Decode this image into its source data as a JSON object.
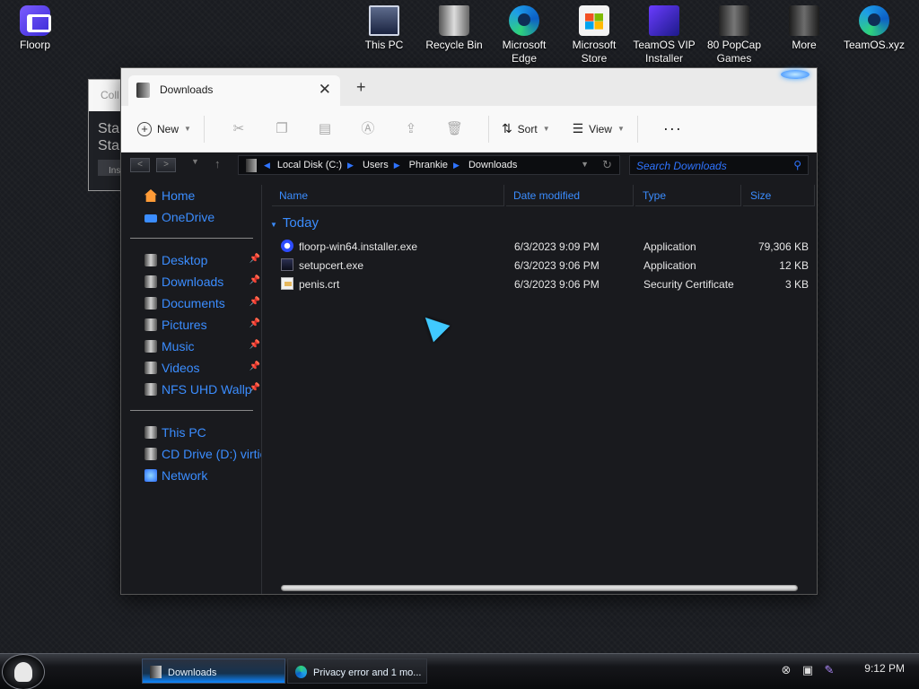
{
  "desktop": {
    "icons": [
      {
        "label": "Floorp",
        "icon": "floorp-icon"
      },
      {
        "label": "This PC",
        "icon": "this-pc-icon"
      },
      {
        "label": "Recycle Bin",
        "icon": "recycle-bin-icon"
      },
      {
        "label": "Microsoft Edge",
        "icon": "edge-icon"
      },
      {
        "label": "Microsoft Store",
        "icon": "store-icon"
      },
      {
        "label": "TeamOS VIP Installer",
        "icon": "teamos-icon"
      },
      {
        "label": "80 PopCap Games",
        "icon": "popcap-icon"
      },
      {
        "label": "More",
        "icon": "more-folder-icon"
      },
      {
        "label": "TeamOS.xyz",
        "icon": "edge-icon"
      }
    ]
  },
  "background_window": {
    "tab_label": "Coll",
    "body_line1": "Sta",
    "body_line2": "Sta",
    "button_label": "Ins"
  },
  "explorer": {
    "tab_title": "Downloads",
    "toolbar": {
      "new_label": "New",
      "sort_label": "Sort",
      "view_label": "View"
    },
    "address": {
      "crumbs": [
        "Local Disk (C:)",
        "Users",
        "Phrankie",
        "Downloads"
      ]
    },
    "search_placeholder": "Search Downloads",
    "sidebar": {
      "items": [
        {
          "label": "Home",
          "icon": "home-icon",
          "pinned": false
        },
        {
          "label": "OneDrive",
          "icon": "onedrive-icon",
          "pinned": false
        },
        {
          "label": "Desktop",
          "icon": "desktop-folder-icon",
          "pinned": true
        },
        {
          "label": "Downloads",
          "icon": "downloads-folder-icon",
          "pinned": true
        },
        {
          "label": "Documents",
          "icon": "documents-folder-icon",
          "pinned": true
        },
        {
          "label": "Pictures",
          "icon": "pictures-folder-icon",
          "pinned": true
        },
        {
          "label": "Music",
          "icon": "music-folder-icon",
          "pinned": true
        },
        {
          "label": "Videos",
          "icon": "videos-folder-icon",
          "pinned": true
        },
        {
          "label": "NFS UHD Wallp",
          "icon": "folder-icon",
          "pinned": true
        },
        {
          "label": "This PC",
          "icon": "this-pc-icon",
          "pinned": false
        },
        {
          "label": "CD Drive (D:) virtio-",
          "icon": "cd-drive-icon",
          "pinned": false
        },
        {
          "label": "Network",
          "icon": "network-icon",
          "pinned": false
        }
      ]
    },
    "columns": [
      "Name",
      "Date modified",
      "Type",
      "Size"
    ],
    "group_label": "Today",
    "files": [
      {
        "name": "floorp-win64.installer.exe",
        "date": "6/3/2023 9:09 PM",
        "type": "Application",
        "size": "79,306 KB",
        "icon": "floorp-installer-icon"
      },
      {
        "name": "setupcert.exe",
        "date": "6/3/2023 9:06 PM",
        "type": "Application",
        "size": "12 KB",
        "icon": "setup-exe-icon"
      },
      {
        "name": "penis.crt",
        "date": "6/3/2023 9:06 PM",
        "type": "Security Certificate",
        "size": "3 KB",
        "icon": "certificate-icon"
      }
    ]
  },
  "taskbar": {
    "buttons": [
      {
        "label": "Downloads",
        "active": true
      },
      {
        "label": "Privacy error and 1 mo...",
        "active": false
      }
    ],
    "clock": "9:12 PM"
  },
  "colors": {
    "accent": "#3b8dff",
    "window_bg": "#191a1e",
    "toolbar_bg": "#f9f9f9",
    "taskbar_active": "#0f87ff"
  }
}
